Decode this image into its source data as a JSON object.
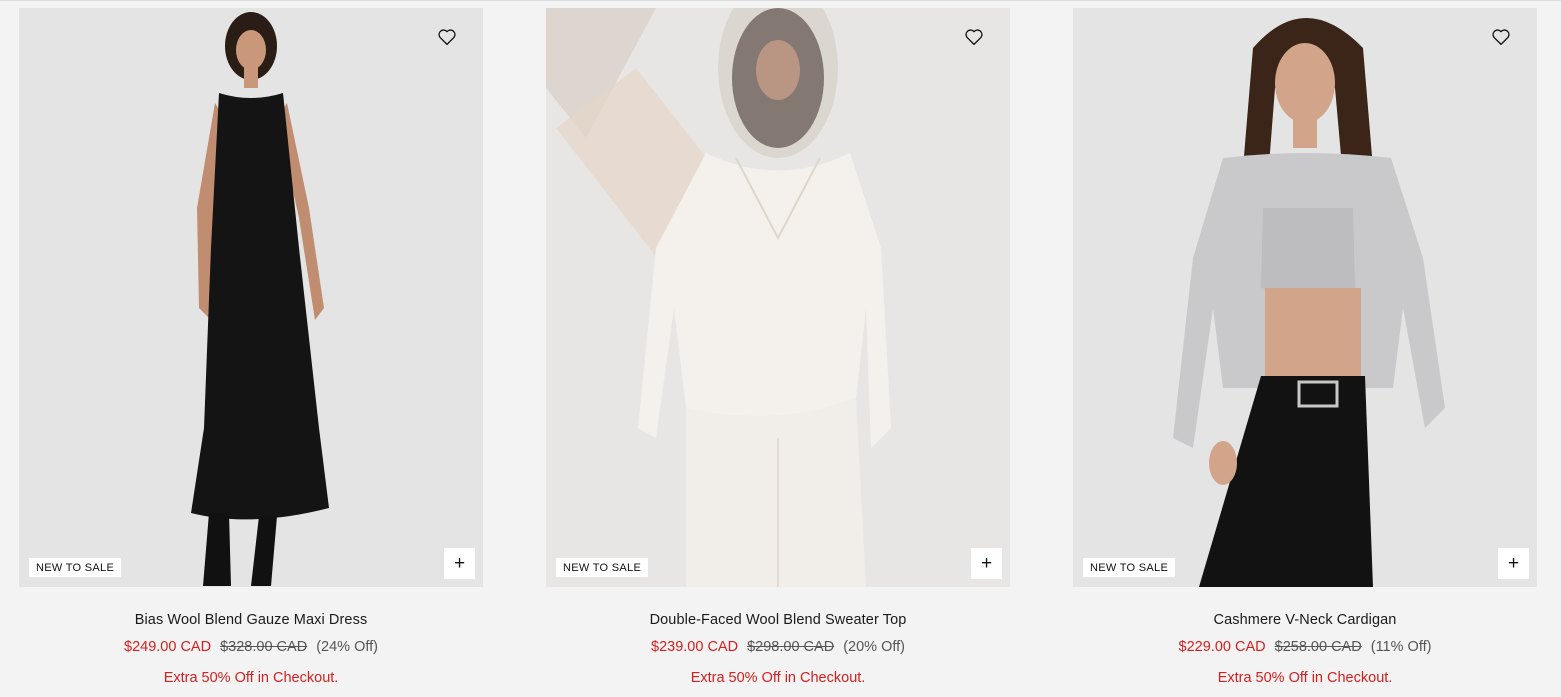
{
  "products": [
    {
      "name": "Bias Wool Blend Gauze Maxi Dress",
      "badge": "NEW TO SALE",
      "sale_price": "$249.00 CAD",
      "original_price": "$328.00 CAD",
      "discount": "(24% Off)",
      "promo": "Extra 50% Off in Checkout.",
      "wishlist_icon": "heart-outline-icon",
      "add_icon": "plus-icon",
      "add_label": "+"
    },
    {
      "name": "Double-Faced Wool Blend Sweater Top",
      "badge": "NEW TO SALE",
      "sale_price": "$239.00 CAD",
      "original_price": "$298.00 CAD",
      "discount": "(20% Off)",
      "promo": "Extra 50% Off in Checkout.",
      "wishlist_icon": "heart-outline-icon",
      "add_icon": "plus-icon",
      "add_label": "+"
    },
    {
      "name": "Cashmere V-Neck Cardigan",
      "badge": "NEW TO SALE",
      "sale_price": "$229.00 CAD",
      "original_price": "$258.00 CAD",
      "discount": "(11% Off)",
      "promo": "Extra 50% Off in Checkout.",
      "wishlist_icon": "heart-outline-icon",
      "add_icon": "plus-icon",
      "add_label": "+"
    }
  ],
  "colors": {
    "page_background": "#f3f3f3",
    "image_background": "#e6e6e6",
    "sale_red": "#d42020",
    "muted_text": "#555555"
  }
}
